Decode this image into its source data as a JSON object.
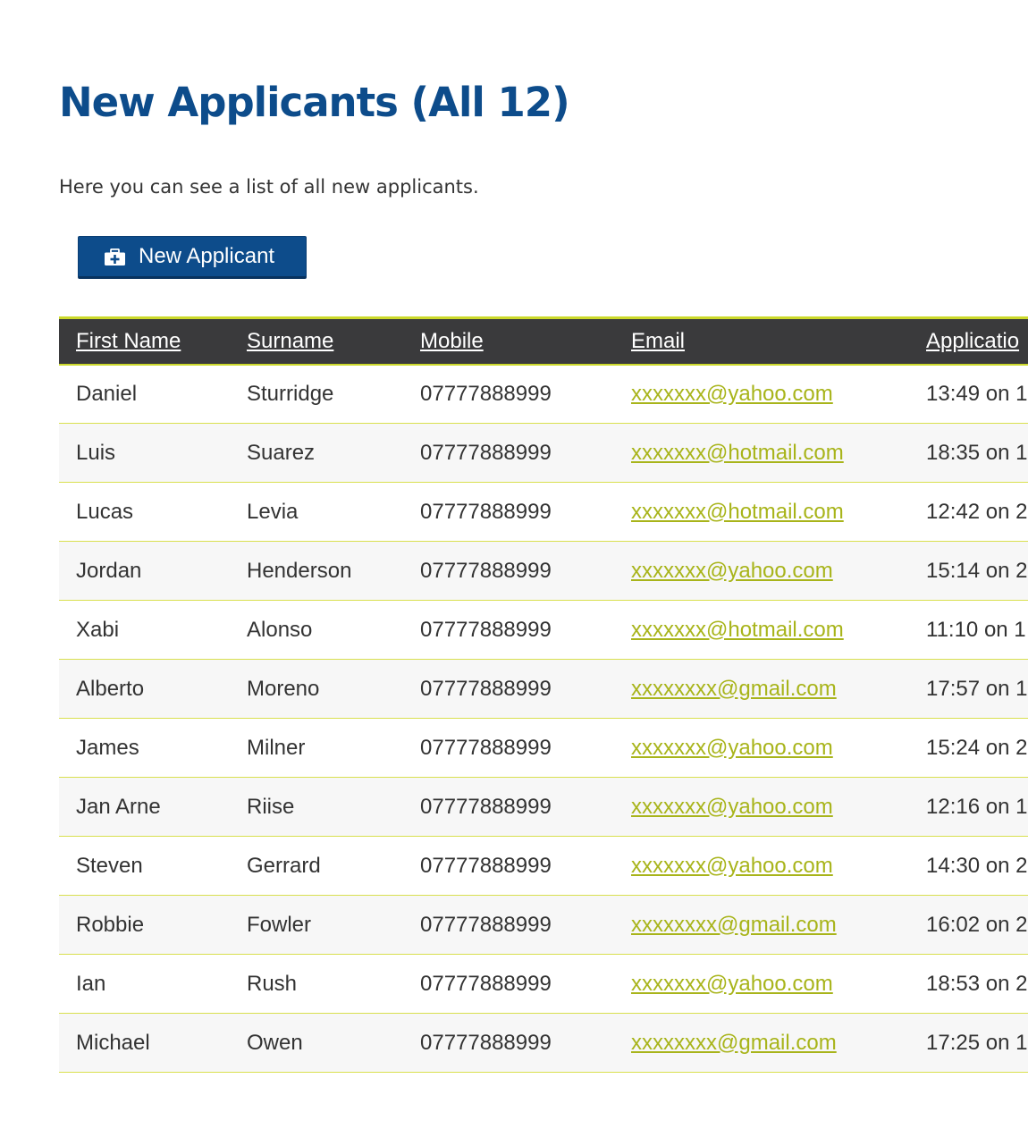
{
  "page": {
    "title": "New Applicants (All 12)",
    "intro": "Here you can see a list of all new applicants."
  },
  "toolbar": {
    "new_applicant_label": "New Applicant",
    "new_applicant_icon": "briefcase-add-icon"
  },
  "colors": {
    "title": "#0d4c8b",
    "button": "#0d4c8b",
    "header_bg": "#3a3a3c",
    "accent": "#ccd92b",
    "link": "#a8b41a"
  },
  "table": {
    "columns": [
      "First Name",
      "Surname",
      "Mobile",
      "Email",
      "Applicatio"
    ],
    "rows": [
      {
        "first": "Daniel",
        "surname": "Sturridge",
        "mobile": "07777888999",
        "email": "xxxxxxx@yahoo.com",
        "applied": "13:49 on 1"
      },
      {
        "first": "Luis",
        "surname": "Suarez",
        "mobile": "07777888999",
        "email": "xxxxxxx@hotmail.com",
        "applied": "18:35 on 1"
      },
      {
        "first": "Lucas",
        "surname": "Levia",
        "mobile": "07777888999",
        "email": "xxxxxxx@hotmail.com",
        "applied": "12:42 on 2"
      },
      {
        "first": "Jordan",
        "surname": "Henderson",
        "mobile": "07777888999",
        "email": "xxxxxxx@yahoo.com",
        "applied": "15:14 on 2"
      },
      {
        "first": "Xabi",
        "surname": "Alonso",
        "mobile": "07777888999",
        "email": "xxxxxxx@hotmail.com",
        "applied": "11:10 on 1"
      },
      {
        "first": "Alberto",
        "surname": "Moreno",
        "mobile": "07777888999",
        "email": "xxxxxxxx@gmail.com",
        "applied": "17:57 on 1"
      },
      {
        "first": "James",
        "surname": "Milner",
        "mobile": "07777888999",
        "email": "xxxxxxx@yahoo.com",
        "applied": "15:24 on 2"
      },
      {
        "first": "Jan Arne",
        "surname": "Riise",
        "mobile": "07777888999",
        "email": "xxxxxxx@yahoo.com",
        "applied": "12:16 on 1"
      },
      {
        "first": "Steven",
        "surname": "Gerrard",
        "mobile": "07777888999",
        "email": "xxxxxxx@yahoo.com",
        "applied": "14:30 on 2"
      },
      {
        "first": "Robbie",
        "surname": "Fowler",
        "mobile": "07777888999",
        "email": "xxxxxxxx@gmail.com",
        "applied": "16:02 on 2"
      },
      {
        "first": "Ian",
        "surname": "Rush",
        "mobile": "07777888999",
        "email": "xxxxxxx@yahoo.com",
        "applied": "18:53 on 2"
      },
      {
        "first": "Michael",
        "surname": "Owen",
        "mobile": "07777888999",
        "email": "xxxxxxxx@gmail.com",
        "applied": "17:25 on 1"
      }
    ]
  }
}
